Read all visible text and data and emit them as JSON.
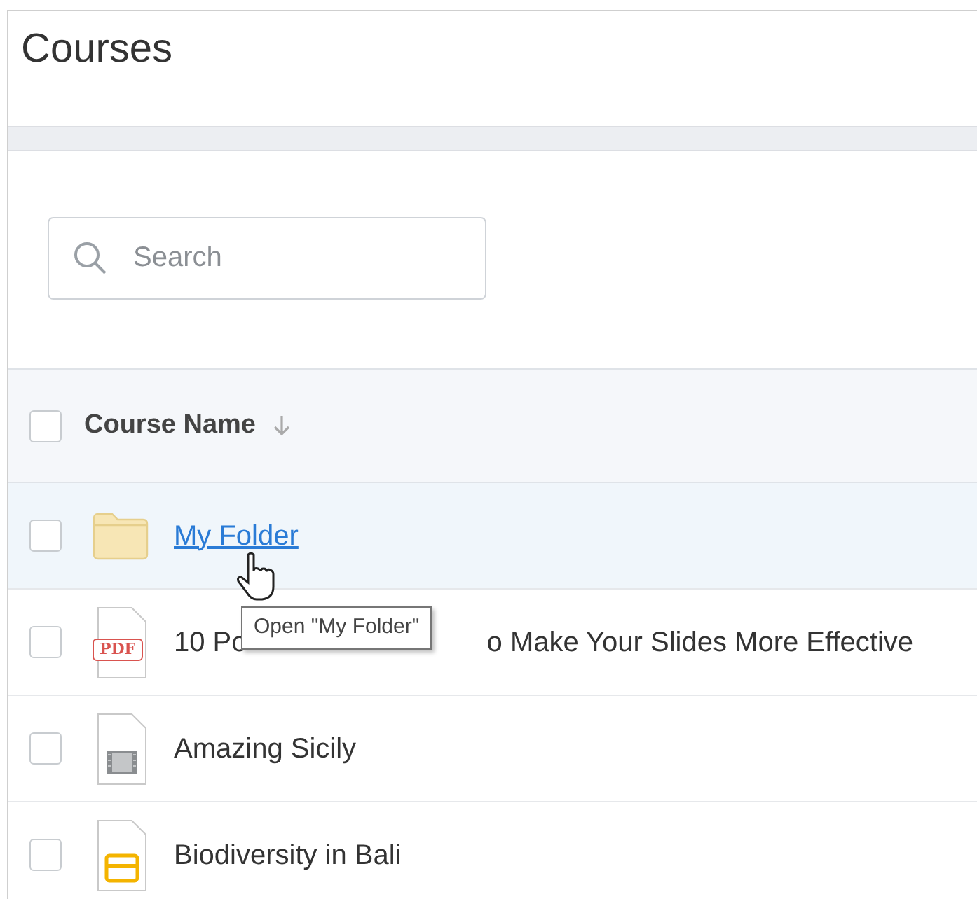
{
  "page": {
    "title": "Courses"
  },
  "search": {
    "placeholder": "Search"
  },
  "table": {
    "columns": [
      {
        "label": "Course Name",
        "checked": false
      }
    ],
    "rows": [
      {
        "kind": "folder",
        "selected": false,
        "hovered": true,
        "checked": false,
        "parts": [
          "My Folder"
        ]
      },
      {
        "kind": "pdf",
        "selected": false,
        "hovered": false,
        "checked": false,
        "badge": "PDF",
        "parts": [
          "10 Po",
          "o Make Your Slides More Effective"
        ]
      },
      {
        "kind": "video",
        "selected": false,
        "hovered": false,
        "checked": false,
        "parts": [
          "Amazing Sicily"
        ]
      },
      {
        "kind": "slides",
        "selected": false,
        "hovered": false,
        "checked": false,
        "parts": [
          "Biodiversity in Bali"
        ]
      }
    ]
  },
  "tooltip": {
    "text": "Open \"My Folder\""
  }
}
